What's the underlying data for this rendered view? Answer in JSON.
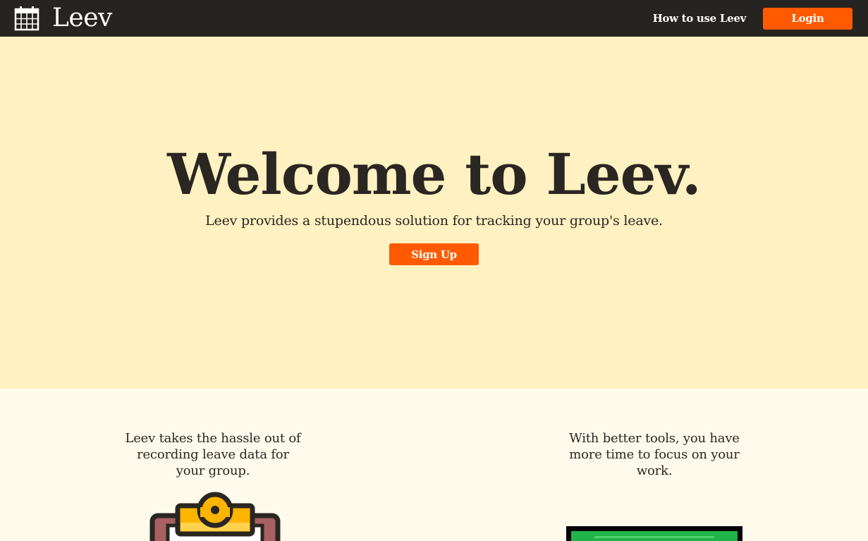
{
  "navbar": {
    "logo_icon": "calendar-icon",
    "brand": "Leev",
    "how_to_link": "How to use Leev",
    "login_label": "Login"
  },
  "hero": {
    "title": "Welcome to Leev.",
    "subtitle": "Leev provides a stupendous solution for tracking your group's leave.",
    "signup_label": "Sign Up"
  },
  "features": [
    {
      "text": "Leev takes the hassle out of recording leave data for your group.",
      "illustration": "clipboard-icon"
    },
    {
      "text": "With better tools, you have more time to focus on your work.",
      "illustration": "monitor-icon"
    }
  ],
  "colors": {
    "navbar_bg": "#262420",
    "accent": "#ff5a00",
    "hero_bg": "#fff1c1",
    "page_bg": "#fffbec",
    "text": "#2a2622"
  }
}
